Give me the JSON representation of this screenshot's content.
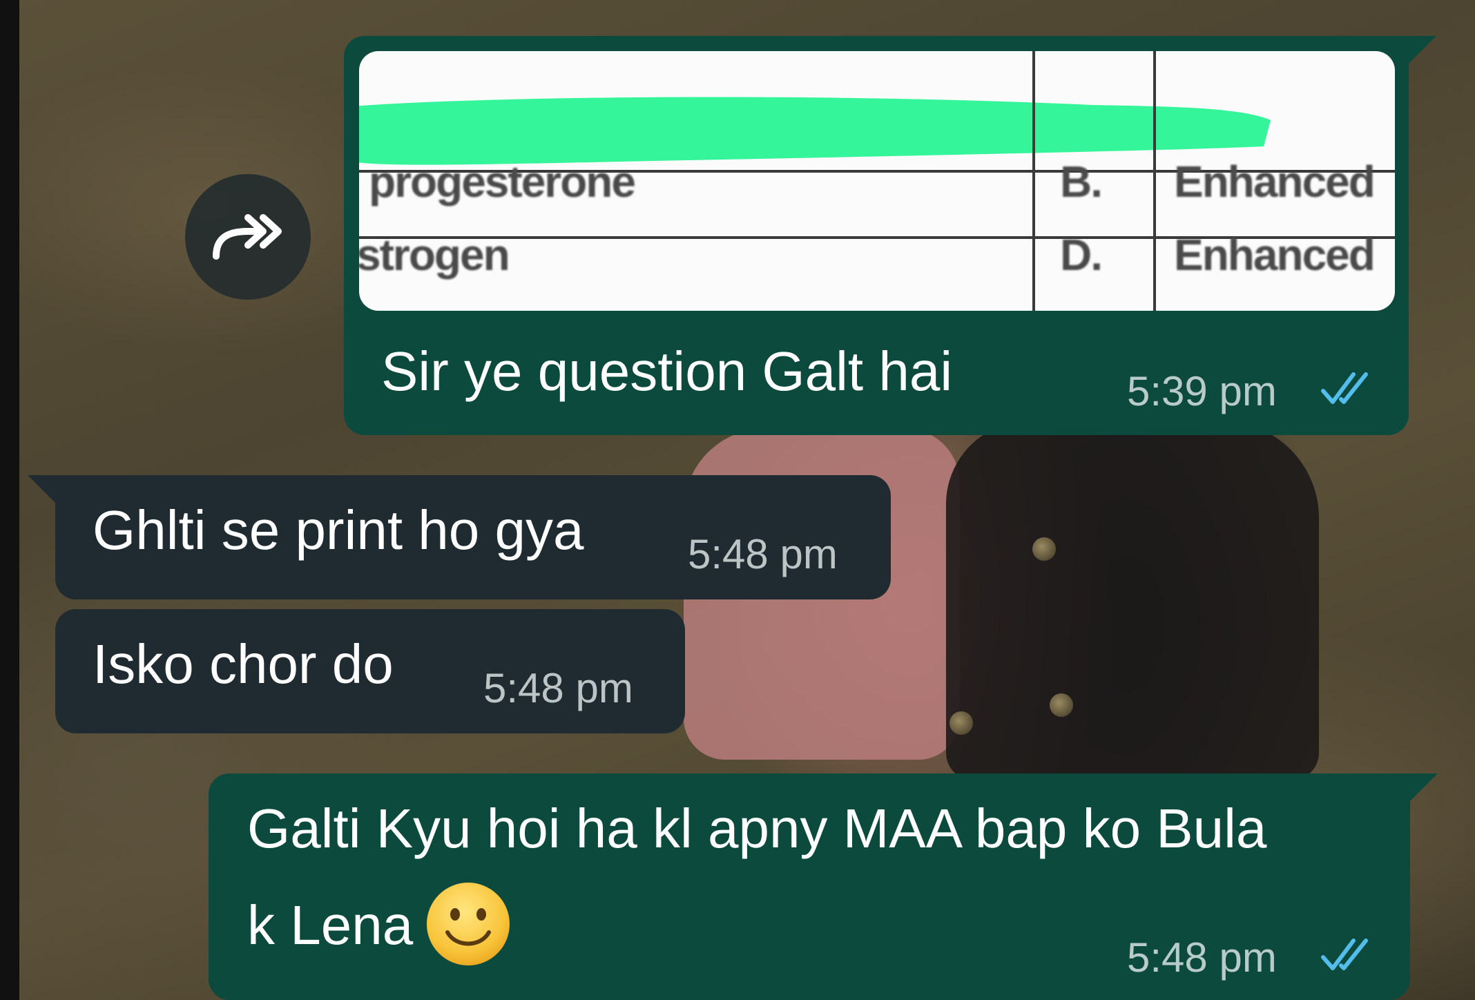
{
  "chat": {
    "messages": [
      {
        "direction": "outgoing",
        "has_image": true,
        "image_preview": {
          "rows": [
            {
              "left": "progesterone",
              "letter": "B.",
              "right": "Enhanced"
            },
            {
              "left": "strogen",
              "letter": "D.",
              "right": "Enhanced"
            }
          ],
          "highlight_color": "#35f59a"
        },
        "text": "Sir ye question Galt hai",
        "time": "5:39 pm",
        "status": "read"
      },
      {
        "direction": "incoming",
        "text": "Ghlti se print ho gya",
        "time": "5:48 pm"
      },
      {
        "direction": "incoming",
        "text": "Isko chor do",
        "time": "5:48 pm"
      },
      {
        "direction": "outgoing",
        "text_line1": "Galti Kyu hoi ha kl apny MAA bap ko Bula",
        "text_line2": "k Lena",
        "emoji": "slightly-smiling-face",
        "time": "5:48 pm",
        "status": "read"
      }
    ],
    "forward_icon": "forward-icon"
  },
  "colors": {
    "outgoing_bubble": "#0b4a3c",
    "incoming_bubble": "#1f2b30",
    "read_ticks": "#53bdeb"
  }
}
